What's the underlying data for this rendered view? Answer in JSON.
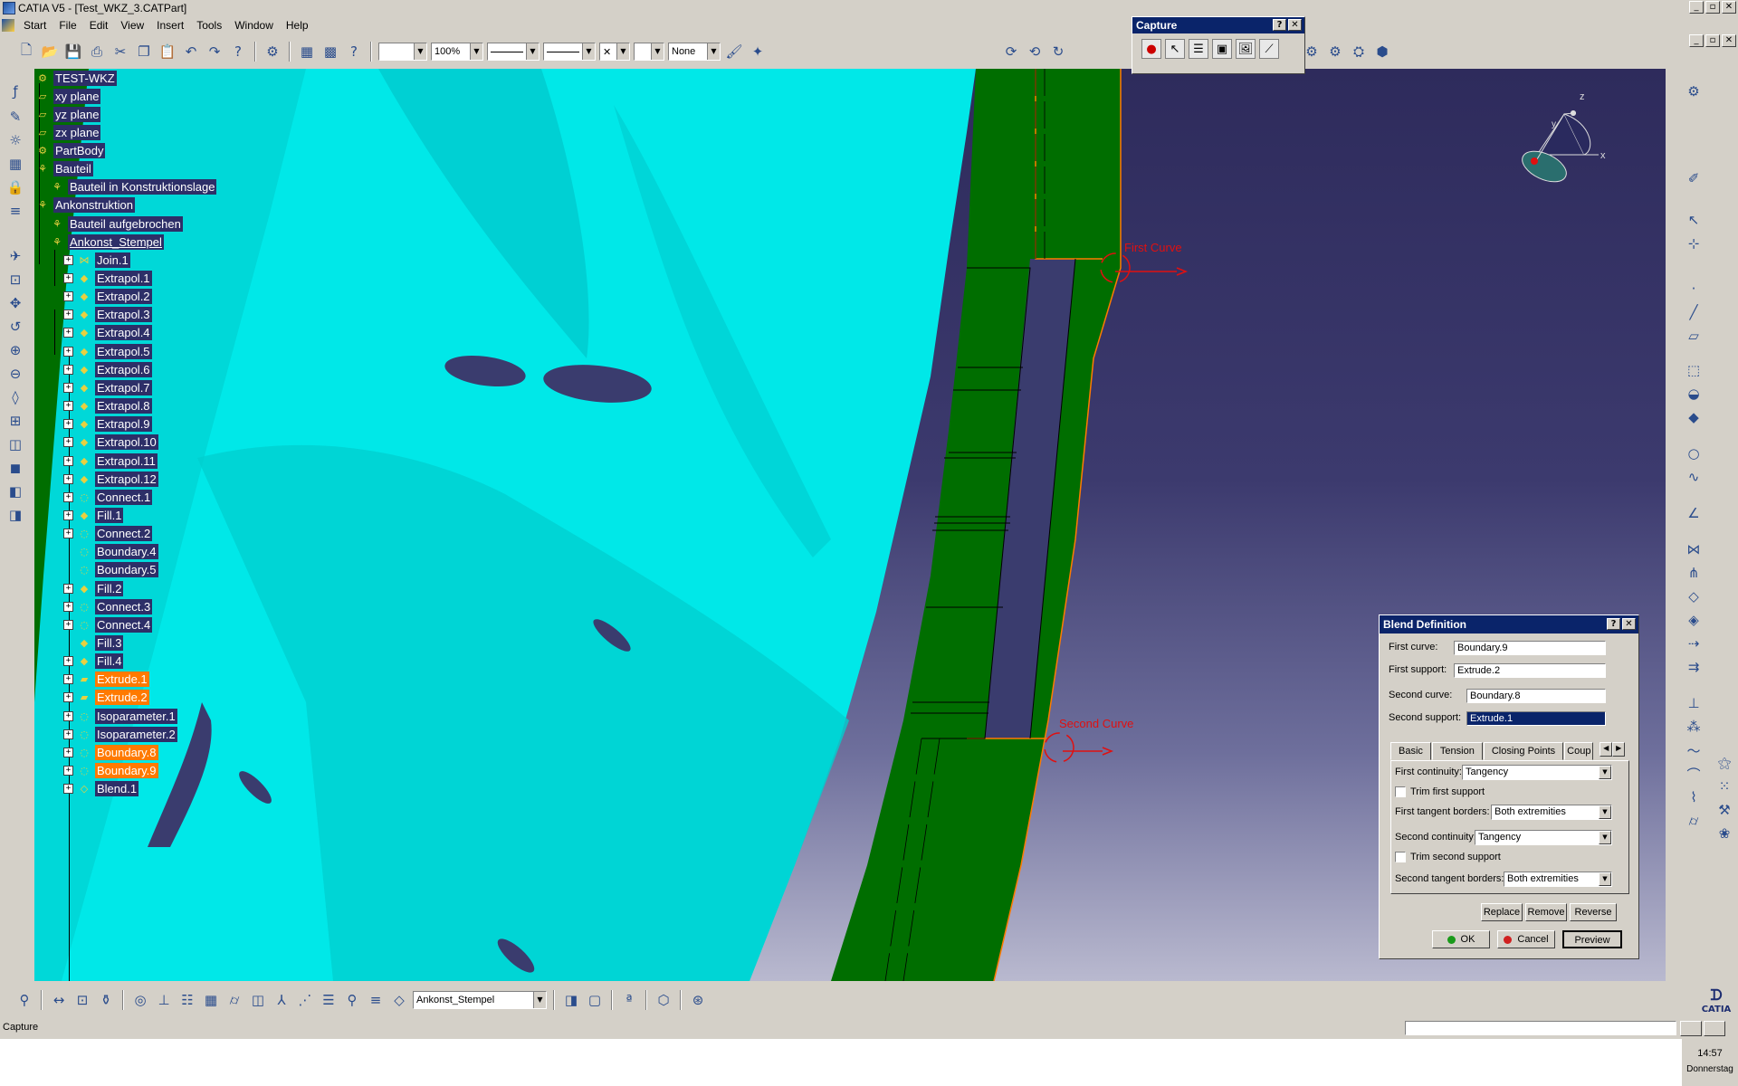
{
  "window": {
    "title": "CATIA V5 - [Test_WKZ_3.CATPart]"
  },
  "menu": [
    "Start",
    "File",
    "Edit",
    "View",
    "Insert",
    "Tools",
    "Window",
    "Help"
  ],
  "toolbar": {
    "zoom_value": "100%",
    "layer_value": "None"
  },
  "tree": {
    "root": "TEST-WKZ",
    "nodes": [
      {
        "label": "xy plane",
        "level": 1,
        "highlight": false
      },
      {
        "label": "yz plane",
        "level": 1,
        "highlight": false
      },
      {
        "label": "zx plane",
        "level": 1,
        "highlight": false
      },
      {
        "label": "PartBody",
        "level": 1,
        "highlight": false
      },
      {
        "label": "Bauteil",
        "level": 1,
        "highlight": false
      },
      {
        "label": "Bauteil in Konstruktionslage",
        "level": 2,
        "highlight": false
      },
      {
        "label": "Ankonstruktion",
        "level": 1,
        "highlight": false
      },
      {
        "label": "Bauteil aufgebrochen",
        "level": 2,
        "highlight": false
      },
      {
        "label": "Ankonst_Stempel",
        "level": 2,
        "highlight": false
      },
      {
        "label": "Join.1",
        "level": 3,
        "highlight": false
      },
      {
        "label": "Extrapol.1",
        "level": 3,
        "highlight": false
      },
      {
        "label": "Extrapol.2",
        "level": 3,
        "highlight": false
      },
      {
        "label": "Extrapol.3",
        "level": 3,
        "highlight": false
      },
      {
        "label": "Extrapol.4",
        "level": 3,
        "highlight": false
      },
      {
        "label": "Extrapol.5",
        "level": 3,
        "highlight": false
      },
      {
        "label": "Extrapol.6",
        "level": 3,
        "highlight": false
      },
      {
        "label": "Extrapol.7",
        "level": 3,
        "highlight": false
      },
      {
        "label": "Extrapol.8",
        "level": 3,
        "highlight": false
      },
      {
        "label": "Extrapol.9",
        "level": 3,
        "highlight": false
      },
      {
        "label": "Extrapol.10",
        "level": 3,
        "highlight": false
      },
      {
        "label": "Extrapol.11",
        "level": 3,
        "highlight": false
      },
      {
        "label": "Extrapol.12",
        "level": 3,
        "highlight": false
      },
      {
        "label": "Connect.1",
        "level": 3,
        "highlight": false
      },
      {
        "label": "Fill.1",
        "level": 3,
        "highlight": false
      },
      {
        "label": "Connect.2",
        "level": 3,
        "highlight": false
      },
      {
        "label": "Boundary.4",
        "level": 3,
        "highlight": false
      },
      {
        "label": "Boundary.5",
        "level": 3,
        "highlight": false
      },
      {
        "label": "Fill.2",
        "level": 3,
        "highlight": false
      },
      {
        "label": "Connect.3",
        "level": 3,
        "highlight": false
      },
      {
        "label": "Connect.4",
        "level": 3,
        "highlight": false
      },
      {
        "label": "Fill.3",
        "level": 3,
        "highlight": false
      },
      {
        "label": "Fill.4",
        "level": 3,
        "highlight": false
      },
      {
        "label": "Extrude.1",
        "level": 3,
        "highlight": true
      },
      {
        "label": "Extrude.2",
        "level": 3,
        "highlight": true
      },
      {
        "label": "Isoparameter.1",
        "level": 3,
        "highlight": false
      },
      {
        "label": "Isoparameter.2",
        "level": 3,
        "highlight": false
      },
      {
        "label": "Boundary.8",
        "level": 3,
        "highlight": true
      },
      {
        "label": "Boundary.9",
        "level": 3,
        "highlight": true
      },
      {
        "label": "Blend.1",
        "level": 3,
        "highlight": false
      }
    ]
  },
  "viewport": {
    "first_curve_label": "First Curve",
    "second_curve_label": "Second Curve",
    "compass": {
      "z": "z",
      "x": "x",
      "y": "y"
    },
    "colors": {
      "cyan_surface": "#00e8e8",
      "green_surface": "#006e00",
      "highlight_orange": "#ff7a00",
      "curve_red": "#e01010"
    }
  },
  "capture": {
    "title": "Capture"
  },
  "blend": {
    "title": "Blend Definition",
    "first_curve_label": "First curve:",
    "first_curve_value": "Boundary.9",
    "first_support_label": "First support:",
    "first_support_value": "Extrude.2",
    "second_curve_label": "Second curve:",
    "second_curve_value": "Boundary.8",
    "second_support_label": "Second support:",
    "second_support_value": "Extrude.1",
    "tabs": [
      "Basic",
      "Tension",
      "Closing Points",
      "Coup"
    ],
    "first_continuity_label": "First continuity:",
    "first_continuity_value": "Tangency",
    "trim_first_label": "Trim first support",
    "first_tangent_label": "First tangent borders:",
    "first_tangent_value": "Both extremities",
    "second_continuity_label": "Second continuity:",
    "second_continuity_value": "Tangency",
    "trim_second_label": "Trim second support",
    "second_tangent_label": "Second tangent borders:",
    "second_tangent_value": "Both extremities",
    "replace": "Replace",
    "remove": "Remove",
    "reverse": "Reverse",
    "ok": "OK",
    "cancel": "Cancel",
    "preview": "Preview"
  },
  "bottom": {
    "current_body": "Ankonst_Stempel"
  },
  "status": {
    "text": "Capture",
    "time": "14:57",
    "day": "Donnerstag",
    "logo": "CATIA"
  }
}
